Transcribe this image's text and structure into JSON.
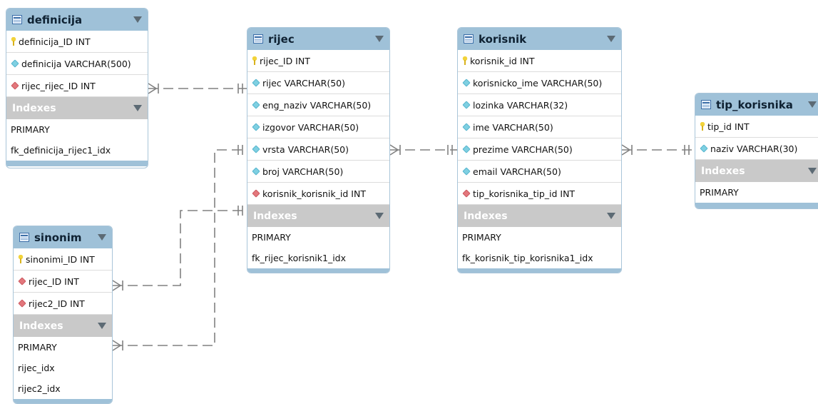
{
  "tables": {
    "definicija": {
      "title": "definicija",
      "columns": [
        {
          "text": "definicija_ID INT",
          "kind": "pk"
        },
        {
          "text": "definicija VARCHAR(500)",
          "kind": "attr"
        },
        {
          "text": "rijec_rijec_ID INT",
          "kind": "fk"
        }
      ],
      "indexes_label": "Indexes",
      "indexes": [
        "PRIMARY",
        "fk_definicija_rijec1_idx"
      ]
    },
    "rijec": {
      "title": "rijec",
      "columns": [
        {
          "text": "rijec_ID INT",
          "kind": "pk"
        },
        {
          "text": "rijec VARCHAR(50)",
          "kind": "attr"
        },
        {
          "text": "eng_naziv VARCHAR(50)",
          "kind": "attr"
        },
        {
          "text": "izgovor VARCHAR(50)",
          "kind": "attr"
        },
        {
          "text": "vrsta VARCHAR(50)",
          "kind": "attr"
        },
        {
          "text": "broj VARCHAR(50)",
          "kind": "attr"
        },
        {
          "text": "korisnik_korisnik_id INT",
          "kind": "fk"
        }
      ],
      "indexes_label": "Indexes",
      "indexes": [
        "PRIMARY",
        "fk_rijec_korisnik1_idx"
      ]
    },
    "korisnik": {
      "title": "korisnik",
      "columns": [
        {
          "text": "korisnik_id INT",
          "kind": "pk"
        },
        {
          "text": "korisnicko_ime VARCHAR(50)",
          "kind": "attr"
        },
        {
          "text": "lozinka VARCHAR(32)",
          "kind": "attr"
        },
        {
          "text": "ime VARCHAR(50)",
          "kind": "attr"
        },
        {
          "text": "prezime VARCHAR(50)",
          "kind": "attr"
        },
        {
          "text": "email VARCHAR(50)",
          "kind": "attr"
        },
        {
          "text": "tip_korisnika_tip_id INT",
          "kind": "fk"
        }
      ],
      "indexes_label": "Indexes",
      "indexes": [
        "PRIMARY",
        "fk_korisnik_tip_korisnika1_idx"
      ]
    },
    "tip_korisnika": {
      "title": "tip_korisnika",
      "columns": [
        {
          "text": "tip_id INT",
          "kind": "pk"
        },
        {
          "text": "naziv VARCHAR(30)",
          "kind": "attr"
        }
      ],
      "indexes_label": "Indexes",
      "indexes": [
        "PRIMARY"
      ]
    },
    "sinonim": {
      "title": "sinonim",
      "columns": [
        {
          "text": "sinonimi_ID INT",
          "kind": "pk"
        },
        {
          "text": "rijec_ID INT",
          "kind": "fk"
        },
        {
          "text": "rijec2_ID INT",
          "kind": "fk"
        }
      ],
      "indexes_label": "Indexes",
      "indexes": [
        "PRIMARY",
        "rijec_idx",
        "rijec2_idx"
      ]
    }
  },
  "colors": {
    "header": "#9fc1d8",
    "index_header": "#c9c9c9",
    "pk_key": "#f2d33b",
    "attr_diamond": "#7fd0e2",
    "fk_diamond": "#e3777c",
    "connector": "#808080"
  }
}
